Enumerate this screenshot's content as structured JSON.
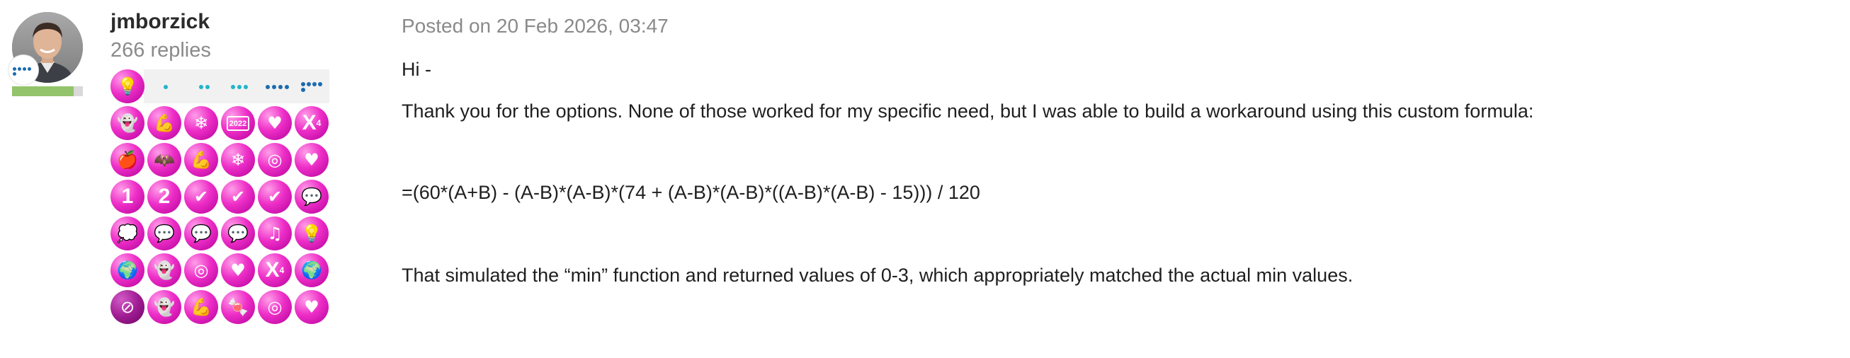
{
  "author": {
    "username": "jmborzick",
    "replies": "266 replies",
    "rank_progress": 0.87
  },
  "post": {
    "posted": "Posted on 20 Feb 2026, 03:47",
    "lines": [
      "Hi -",
      "Thank you for the options. None of those worked for my specific need, but I was able to build a workaround using this custom formula:",
      "=(60*(A+B) - (A-B)*(A-B)*(74 + (A-B)*(A-B)*((A-B)*(A-B) - 15))) / 120",
      "That simulated the “min” function and returned values of 0-3, which appropriately matched the actual min values."
    ]
  },
  "colors": {
    "badge_magenta": "#e619c0",
    "rank_green": "#93c36b",
    "rank_dot_blue": "#1d6bb0",
    "level_teal": "#1fb5c9",
    "level_blue": "#1d6bb0"
  },
  "badges": {
    "level_icon": "lightbulb-icon",
    "rows": [
      [
        {
          "icon": "ghost-icon"
        },
        {
          "icon": "flexed-arm-icon"
        },
        {
          "icon": "snowflake-icon"
        },
        {
          "icon": "calendar-icon",
          "label": "2022"
        },
        {
          "icon": "heart-icon"
        },
        {
          "icon": "x-superscript-icon",
          "label": "X",
          "sup": "4"
        }
      ],
      [
        {
          "icon": "apple-icon"
        },
        {
          "icon": "bat-icon"
        },
        {
          "icon": "flexed-arm-icon"
        },
        {
          "icon": "snowflake-icon"
        },
        {
          "icon": "target-icon"
        },
        {
          "icon": "heart-icon"
        }
      ],
      [
        {
          "icon": "number-badge-icon",
          "label": "1"
        },
        {
          "icon": "number-badge-icon",
          "label": "2"
        },
        {
          "icon": "checkmark-icon"
        },
        {
          "icon": "checkmark-icon"
        },
        {
          "icon": "checkmark-icon"
        },
        {
          "icon": "speech-bubbles-icon"
        }
      ],
      [
        {
          "icon": "speech-bubble-dots-icon"
        },
        {
          "icon": "speech-bubble-icon"
        },
        {
          "icon": "speech-bubble-icon"
        },
        {
          "icon": "speech-bubble-icon"
        },
        {
          "icon": "music-note-icon"
        },
        {
          "icon": "lightbulb-icon"
        }
      ],
      [
        {
          "icon": "globe-icon"
        },
        {
          "icon": "ghost-icon"
        },
        {
          "icon": "target-icon"
        },
        {
          "icon": "heart-icon"
        },
        {
          "icon": "x-superscript-icon",
          "label": "X",
          "sup": "4"
        },
        {
          "icon": "globe-icon"
        }
      ],
      [
        {
          "icon": "year-badge-icon"
        },
        {
          "icon": "ghost-icon"
        },
        {
          "icon": "flexed-arm-icon"
        },
        {
          "icon": "candy-cane-icon"
        },
        {
          "icon": "target-icon"
        },
        {
          "icon": "heart-icon"
        }
      ]
    ]
  }
}
